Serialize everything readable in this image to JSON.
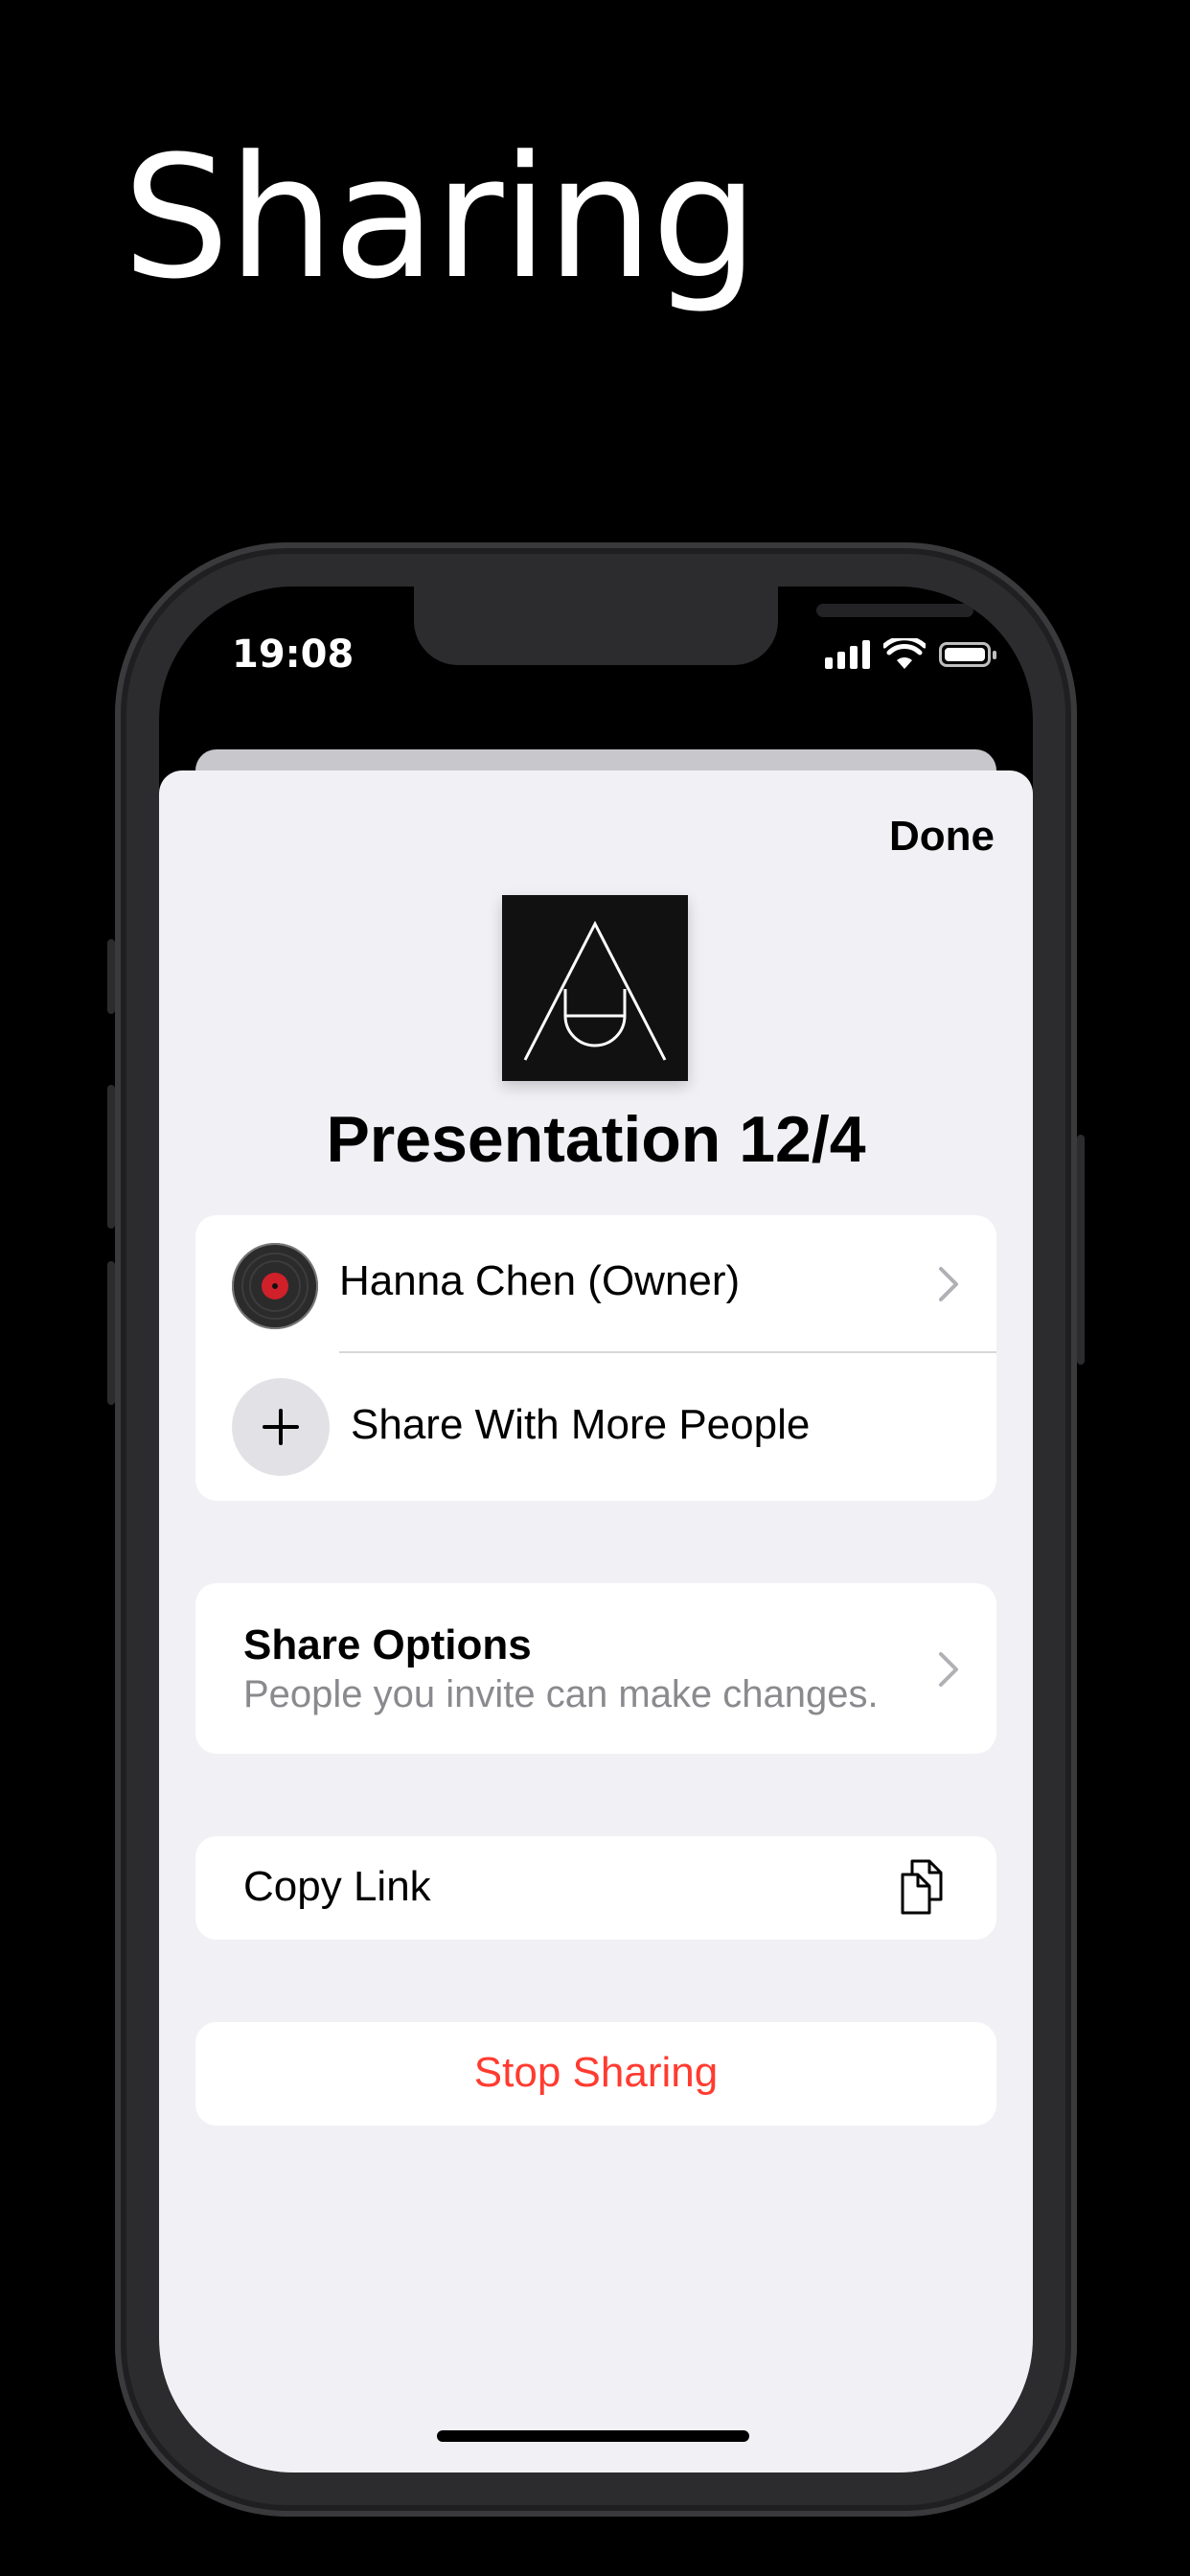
{
  "hero": {
    "title": "Sharing"
  },
  "status_bar": {
    "time": "19:08"
  },
  "sheet": {
    "done_label": "Done",
    "document_title": "Presentation 12/4"
  },
  "people": {
    "owner_label": "Hanna Chen (Owner)",
    "share_more_label": "Share With More People"
  },
  "share_options": {
    "title": "Share Options",
    "subtitle": "People you invite can make changes."
  },
  "copy_link": {
    "label": "Copy Link"
  },
  "stop_sharing": {
    "label": "Stop Sharing"
  },
  "colors": {
    "accent_red": "#ff3b30",
    "sheet_bg": "#f0f0f5",
    "card_bg": "#ffffff",
    "secondary_text": "#8a8a8e"
  },
  "icons": [
    "chevron-right-icon",
    "plus-icon",
    "copy-icon",
    "signal-icon",
    "wifi-icon",
    "battery-icon",
    "app-logo-icon",
    "avatar-record-icon"
  ]
}
